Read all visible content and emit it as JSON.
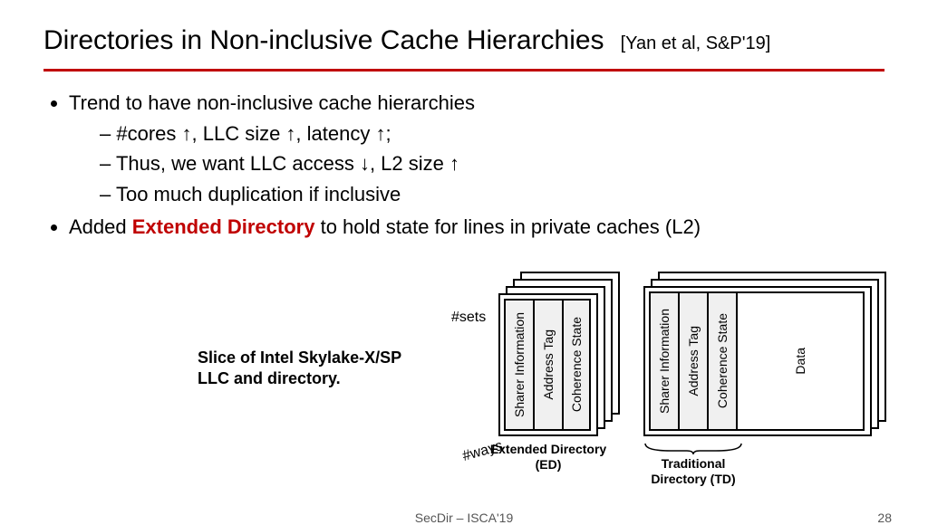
{
  "title": "Directories in Non-inclusive Cache Hierarchies",
  "citation": "[Yan et al, S&P'19]",
  "bullets": {
    "b1": "Trend to have non-inclusive cache hierarchies",
    "b1a": "#cores ↑, LLC size ↑, latency ↑;",
    "b1b": "Thus, we want LLC access ↓, L2 size ↑",
    "b1c": "Too much duplication if inclusive",
    "b2_pre": "Added ",
    "b2_em": "Extended Directory",
    "b2_post": " to hold state for lines in private caches (L2)"
  },
  "diagram": {
    "caption": "Slice of Intel Skylake-X/SP LLC and directory.",
    "sets": "#sets",
    "ways": "#ways",
    "ed_cols": {
      "c1": "Sharer Information",
      "c2": "Address Tag",
      "c3": "Coherence State"
    },
    "td_cols": {
      "c1": "Sharer Information",
      "c2": "Address Tag",
      "c3": "Coherence State",
      "c4": "Data"
    },
    "ed_label": "Extended Directory (ED)",
    "td_label": "Traditional Directory (TD)"
  },
  "footer": {
    "venue": "SecDir – ISCA'19",
    "page": "28"
  }
}
